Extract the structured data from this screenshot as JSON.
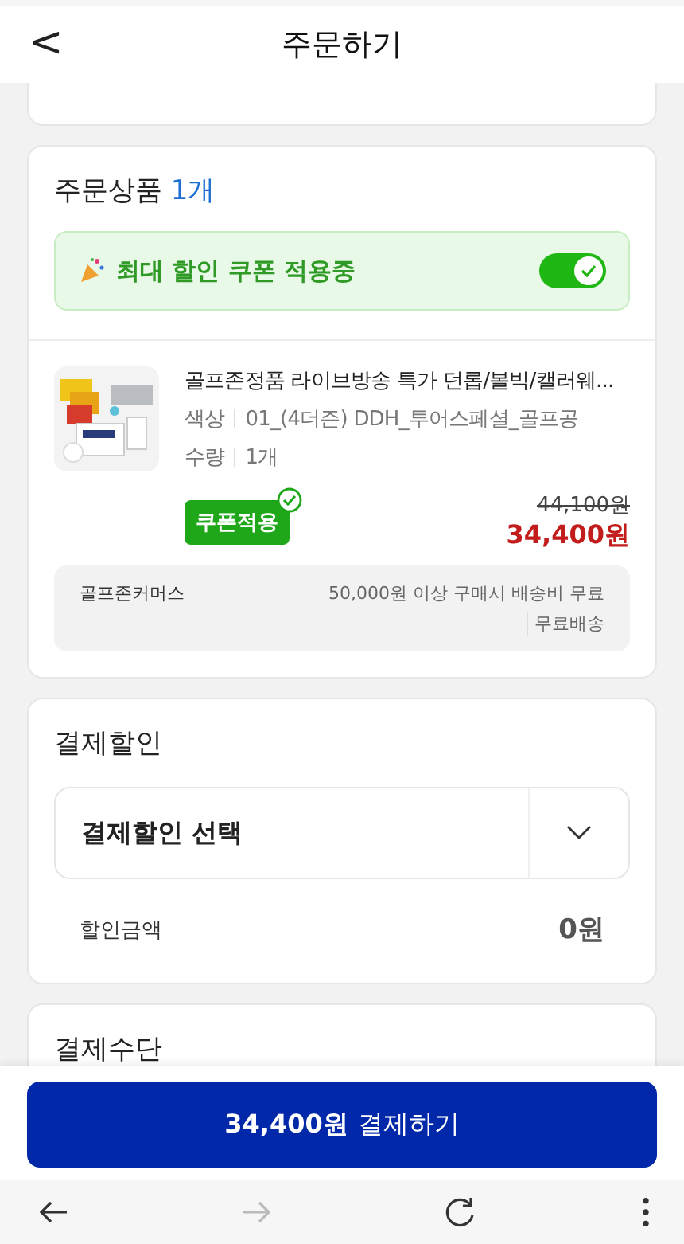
{
  "header": {
    "back": "<",
    "title": "주문하기"
  },
  "order_items": {
    "title": "주문상품",
    "count": "1개",
    "coupon_banner": {
      "label": "최대 할인 쿠폰 적용중",
      "on": true
    },
    "products": [
      {
        "name": "골프존정품 라이브방송 특가 던롭/볼빅/캘러웨...",
        "options": [
          {
            "label": "색상",
            "value": "01_(4더즌) DDH_투어스페셜_골프공"
          },
          {
            "label": "수량",
            "value": "1개"
          }
        ],
        "badge": "쿠폰적용",
        "coupon_applied": true,
        "original_price": "44,100원",
        "price": "34,400원"
      }
    ],
    "shipping": {
      "seller": "골프존커머스",
      "condition": "50,000원 이상 구매시 배송비 무료",
      "fee": "무료배송"
    }
  },
  "payment_discount": {
    "title": "결제할인",
    "select_label": "결제할인 선택",
    "amount_label": "할인금액",
    "amount": "0원"
  },
  "payment_method": {
    "title": "결제수단"
  },
  "pay_button": {
    "amount": "34,400원",
    "label": "결제하기"
  },
  "browser_nav": [
    {
      "kind": "back",
      "disabled": false
    },
    {
      "kind": "forward",
      "disabled": true
    },
    {
      "kind": "reload",
      "disabled": false
    },
    {
      "kind": "menu",
      "disabled": false
    }
  ]
}
